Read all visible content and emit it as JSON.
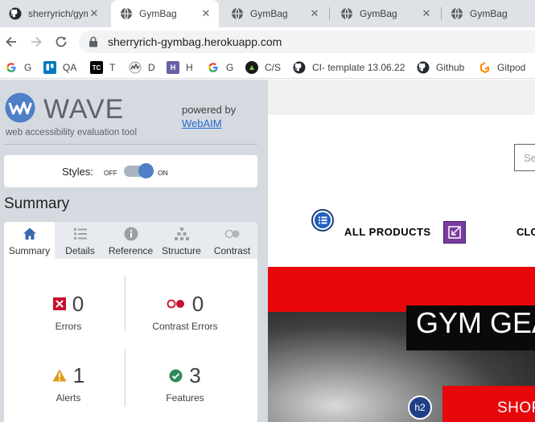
{
  "browser": {
    "tabs": [
      {
        "title": "sherryrich/gymbag",
        "favicon": "github-icon",
        "active": false
      },
      {
        "title": "GymBag",
        "favicon": "globe-icon",
        "active": true
      },
      {
        "title": "GymBag",
        "favicon": "globe-icon",
        "active": false
      },
      {
        "title": "GymBag",
        "favicon": "globe-icon",
        "active": false
      },
      {
        "title": "GymBag",
        "favicon": "globe-icon",
        "active": false
      }
    ],
    "close_glyph": "✕",
    "url": "sherryrich-gymbag.herokuapp.com",
    "bookmarks": [
      {
        "label": "G",
        "icon": "google-icon"
      },
      {
        "label": "QA",
        "icon": "trello-icon"
      },
      {
        "label": "T",
        "icon": "tc-icon"
      },
      {
        "label": "D",
        "icon": "bookmark-d-icon"
      },
      {
        "label": "H",
        "icon": "heroku-icon"
      },
      {
        "label": "G",
        "icon": "google-icon"
      },
      {
        "label": "C/S",
        "icon": "cs-icon"
      },
      {
        "label": "CI- template 13.06.22",
        "icon": "github-icon"
      },
      {
        "label": "Github",
        "icon": "github-icon"
      },
      {
        "label": "Gitpod",
        "icon": "gitpod-icon"
      }
    ]
  },
  "wave": {
    "logo_text": "WAVE",
    "subtitle": "web accessibility evaluation tool",
    "powered_by": "powered by",
    "webaim_link": "WebAIM",
    "styles_label": "Styles:",
    "toggle_off": "OFF",
    "toggle_on": "ON",
    "styles_on": true,
    "summary_heading": "Summary",
    "tabs": [
      {
        "label": "Summary",
        "icon": "home-icon",
        "active": true
      },
      {
        "label": "Details",
        "icon": "list-icon",
        "active": false
      },
      {
        "label": "Reference",
        "icon": "info-icon",
        "active": false
      },
      {
        "label": "Structure",
        "icon": "structure-icon",
        "active": false
      },
      {
        "label": "Contrast",
        "icon": "contrast-icon",
        "active": false
      }
    ],
    "stats": {
      "errors": {
        "count": "0",
        "label": "Errors",
        "icon": "error-icon"
      },
      "contrast": {
        "count": "0",
        "label": "Contrast Errors",
        "icon": "contrast-error-icon"
      },
      "alerts": {
        "count": "1",
        "label": "Alerts",
        "icon": "alert-icon"
      },
      "features": {
        "count": "3",
        "label": "Features",
        "icon": "feature-icon"
      }
    },
    "colors": {
      "panel": "#d5dae0",
      "accent": "#4e7fc7",
      "error": "#c8102e",
      "alert": "#e09b16",
      "feature": "#2e8b57"
    }
  },
  "page": {
    "search_placeholder": "Se",
    "nav_all_products": "ALL PRODUCTS",
    "nav_next": "CLO",
    "hero_title": "GYM GEA",
    "h2_badge": "h2",
    "shop_label": "SHOP",
    "colors": {
      "brand_red": "#e8080c"
    }
  }
}
